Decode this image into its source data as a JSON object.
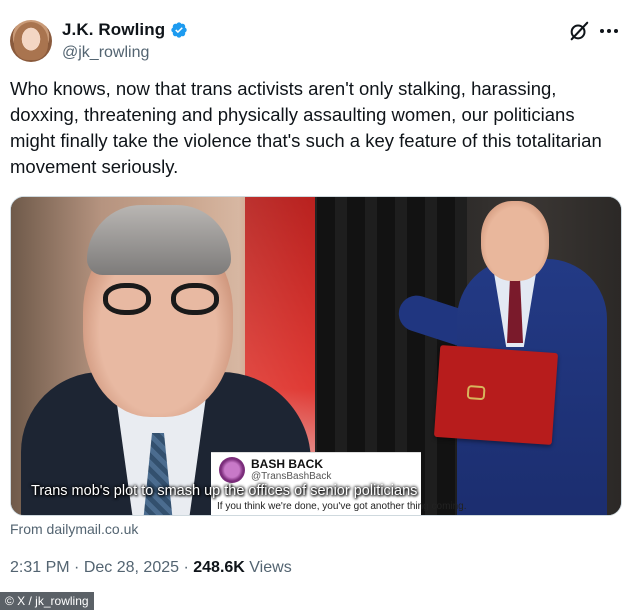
{
  "author": {
    "display_name": "J.K. Rowling",
    "handle": "@jk_rowling",
    "verified": true,
    "avatar": "author-avatar"
  },
  "icons": {
    "verified": "verified-badge-icon",
    "grok": "grok-icon",
    "more": "more-options-icon"
  },
  "tweet": {
    "text": "Who knows, now that trans activists aren't only stalking, harassing, doxxing, threatening and physically assaulting women, our politicians might finally take the violence that's such a key feature of this totalitarian movement seriously."
  },
  "media": {
    "caption": "Trans mob's plot to smash up the offices of senior politicians",
    "inset": {
      "name": "BASH BACK",
      "handle": "@TransBashBack",
      "text": "If you think we're done, you've got another thing coming."
    }
  },
  "source": {
    "label": "From dailymail.co.uk"
  },
  "meta": {
    "time": "2:31 PM",
    "separator": "·",
    "date": "Dec 28, 2025",
    "views_count": "248.6K",
    "views_label": "Views"
  },
  "watermark": {
    "text": "© X / jk_rowling"
  },
  "colors": {
    "text_primary": "#0f1419",
    "text_secondary": "#536471",
    "verified_blue": "#1d9bf0",
    "border": "#cfd9de"
  }
}
